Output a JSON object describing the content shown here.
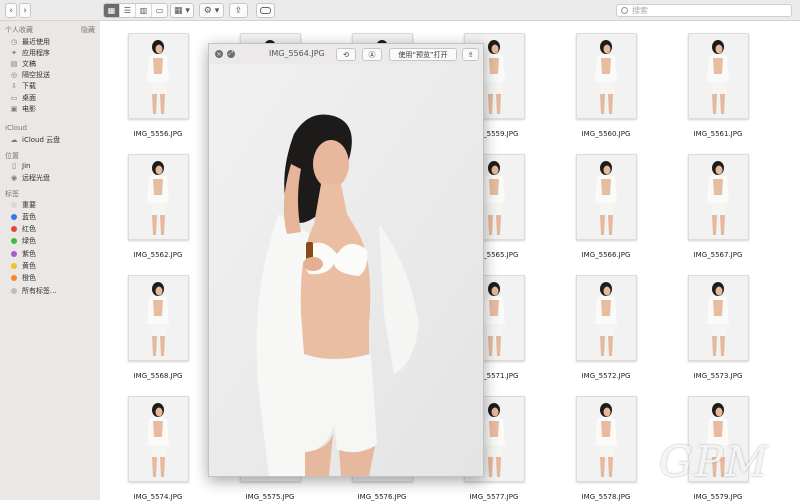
{
  "toolbar": {
    "back_icon": "chevron-left-icon",
    "forward_icon": "chevron-right-icon",
    "view_modes": [
      "icon-view",
      "list-view",
      "column-view",
      "gallery-view"
    ],
    "group_label": "▦ ▾",
    "action_label": "⚙ ▾",
    "share_icon": "share-icon",
    "tag_icon": "tag-icon",
    "search_placeholder": "搜索"
  },
  "sidebar": {
    "favorites_header": "个人收藏",
    "hide_label": "隐藏",
    "favorites": [
      {
        "label": "最近使用",
        "icon": "clock-icon"
      },
      {
        "label": "应用程序",
        "icon": "apps-icon"
      },
      {
        "label": "文稿",
        "icon": "document-icon"
      },
      {
        "label": "隔空投送",
        "icon": "airdrop-icon"
      },
      {
        "label": "下载",
        "icon": "download-icon"
      },
      {
        "label": "桌面",
        "icon": "desktop-icon"
      },
      {
        "label": "电影",
        "icon": "movie-icon"
      }
    ],
    "icloud_header": "iCloud",
    "icloud": [
      {
        "label": "iCloud 云盘",
        "icon": "cloud-icon"
      }
    ],
    "locations_header": "位置",
    "locations": [
      {
        "label": "Jin",
        "icon": "computer-icon"
      },
      {
        "label": "远程光盘",
        "icon": "disc-icon"
      }
    ],
    "tags_header": "标签",
    "tags": [
      {
        "label": "重要",
        "color": "#d9d9d9"
      },
      {
        "label": "蓝色",
        "color": "#2d7be6"
      },
      {
        "label": "红色",
        "color": "#e8433a"
      },
      {
        "label": "绿色",
        "color": "#45b649"
      },
      {
        "label": "紫色",
        "color": "#a65bd9"
      },
      {
        "label": "黄色",
        "color": "#f2c12e"
      },
      {
        "label": "橙色",
        "color": "#f58a2a"
      },
      {
        "label": "所有标签...",
        "color": "#bdbdbd"
      }
    ]
  },
  "files": [
    "IMG_5556.JPG",
    "",
    "",
    "IMG_5559.JPG",
    "IMG_5560.JPG",
    "IMG_5561.JPG",
    "IMG_5562.JPG",
    "",
    "",
    "IMG_5565.JPG",
    "IMG_5566.JPG",
    "IMG_5567.JPG",
    "IMG_5568.JPG",
    "",
    "",
    "IMG_5571.JPG",
    "IMG_5572.JPG",
    "IMG_5573.JPG",
    "IMG_5574.JPG",
    "IMG_5575.JPG",
    "IMG_5576.JPG",
    "IMG_5577.JPG",
    "IMG_5578.JPG",
    "IMG_5579.JPG"
  ],
  "quicklook": {
    "close_icon": "close-icon",
    "fullscreen_icon": "fullscreen-icon",
    "title": "IMG_5564.JPG",
    "rotate_icon": "rotate-icon",
    "markup_icon": "markup-icon",
    "open_with_label": "使用“预览”打开",
    "share_icon": "share-icon"
  },
  "watermark": "GPM"
}
